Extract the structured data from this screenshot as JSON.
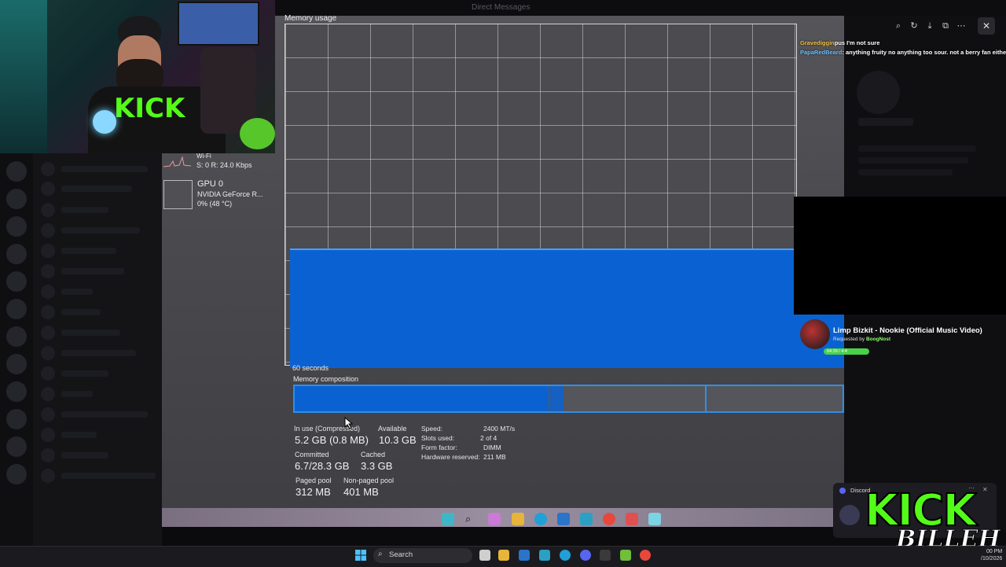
{
  "window": {
    "title": "Direct Messages"
  },
  "photo": {
    "title": "Memory usage",
    "time_span_label": "60 seconds",
    "composition_label": "Memory composition",
    "fill_level": 0.35,
    "sidebar": {
      "wifi_label": "Wi-Fi",
      "wifi_stats": "S: 0 R: 24.0 Kbps",
      "gpu_name": "GPU 0",
      "gpu_model": "NVIDIA GeForce R...",
      "gpu_usage": "0% (48 °C)"
    },
    "stats": {
      "in_use_label": "In use (Compressed)",
      "in_use_value": "5.2 GB (0.8 MB)",
      "available_label": "Available",
      "available_value": "10.3 GB",
      "committed_label": "Committed",
      "committed_value": "6.7/28.3 GB",
      "cached_label": "Cached",
      "cached_value": "3.3 GB",
      "paged_label": "Paged pool",
      "paged_value": "312 MB",
      "nonpaged_label": "Non-paged pool",
      "nonpaged_value": "401 MB"
    },
    "details": {
      "speed_label": "Speed:",
      "speed_value": "2400 MT/s",
      "slots_label": "Slots used:",
      "slots_value": "2 of 4",
      "form_label": "Form factor:",
      "form_value": "DIMM",
      "reserved_label": "Hardware reserved:",
      "reserved_value": "211 MB"
    }
  },
  "chat": [
    {
      "user": "Gravediggin",
      "message": "pus I'm not sure"
    },
    {
      "user": "PapaRedBeard",
      "message": ": anything fruity no anything too sour. not a berry fan either"
    }
  ],
  "song": {
    "title": "Limp Bizkit - Nookie (Official Music Video)",
    "requested_prefix": "Requested by",
    "requester": "BoogNost",
    "progress": "04:39 / 4:4"
  },
  "notification": {
    "app": "Discord"
  },
  "overlay": {
    "brand": "KICK",
    "name": "BILLEH"
  },
  "taskbar": {
    "search_placeholder": "Search",
    "time": "00 PM",
    "date": "/10/2026"
  },
  "colors": {
    "accent_blue": "#0a62d2",
    "kick_green": "#53fc18",
    "chat_user": "#f5c542",
    "chat_user2": "#6ec3ff"
  }
}
